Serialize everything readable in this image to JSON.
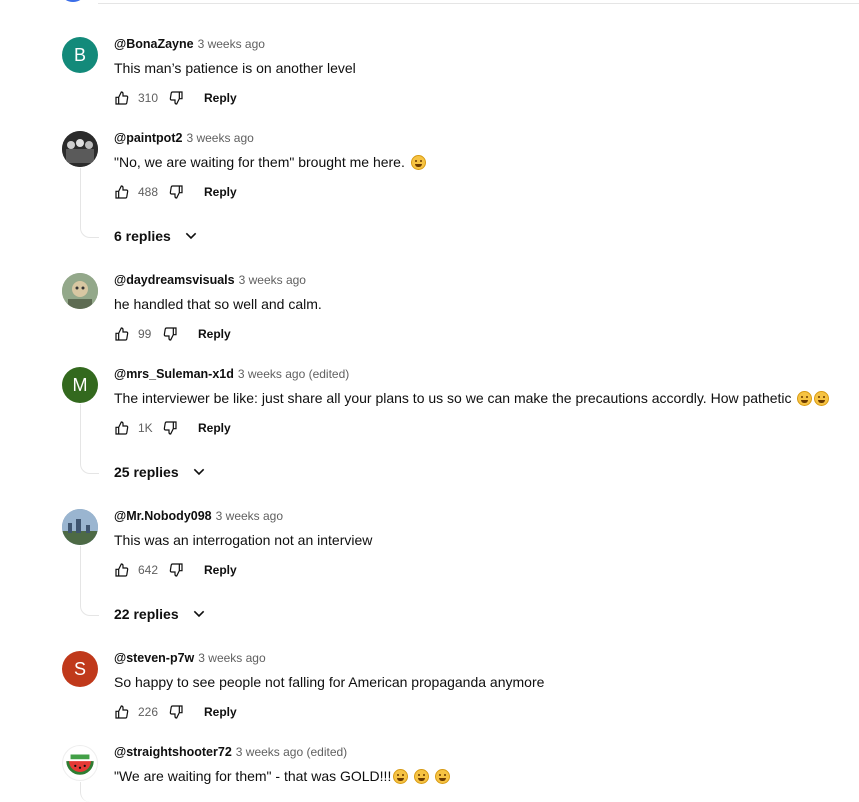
{
  "labels": {
    "reply": "Reply"
  },
  "comments": [
    {
      "author": "@BonaZayne",
      "time": "3 weeks ago",
      "text": "This man’s patience is on another level",
      "likes": "310",
      "avatar_letter": "B",
      "avatar_color": "#138a7a",
      "emojis": []
    },
    {
      "author": "@paintpot2",
      "time": "3 weeks ago",
      "text": "\"No, we are waiting for them\" brought me here.  ",
      "likes": "488",
      "avatar_letter": "",
      "avatar_color": "#3a3a3a",
      "emojis": [
        "joy"
      ],
      "replies": "6 replies"
    },
    {
      "author": "@daydreamsvisuals",
      "time": "3 weeks ago",
      "text": "he handled that so well and calm.",
      "likes": "99",
      "avatar_letter": "",
      "avatar_color": "#8a9a85",
      "emojis": []
    },
    {
      "author": "@mrs_Suleman-x1d",
      "time": "3 weeks ago (edited)",
      "text": "The interviewer be like: just share all your plans to us so we can make the precautions accordly. How pathetic ",
      "likes": "1K",
      "avatar_letter": "M",
      "avatar_color": "#33691e",
      "emojis": [
        "joy",
        "joy"
      ],
      "replies": "25 replies"
    },
    {
      "author": "@Mr.Nobody098",
      "time": "3 weeks ago",
      "text": "This was an interrogation not an interview",
      "likes": "642",
      "avatar_letter": "",
      "avatar_color": "#6f8fae",
      "emojis": [],
      "replies": "22 replies"
    },
    {
      "author": "@steven-p7w",
      "time": "3 weeks ago",
      "text": "So happy to see people not falling for American propaganda anymore",
      "likes": "226",
      "avatar_letter": "S",
      "avatar_color": "#c0391b",
      "emojis": []
    },
    {
      "author": "@straightshooter72",
      "time": "3 weeks ago (edited)",
      "text": "\"We are waiting for them\" - that was GOLD!!!",
      "likes": "",
      "avatar_letter": "",
      "avatar_color": "#ffffff",
      "emojis": [
        "rofl",
        "joy",
        "rofl"
      ]
    }
  ]
}
